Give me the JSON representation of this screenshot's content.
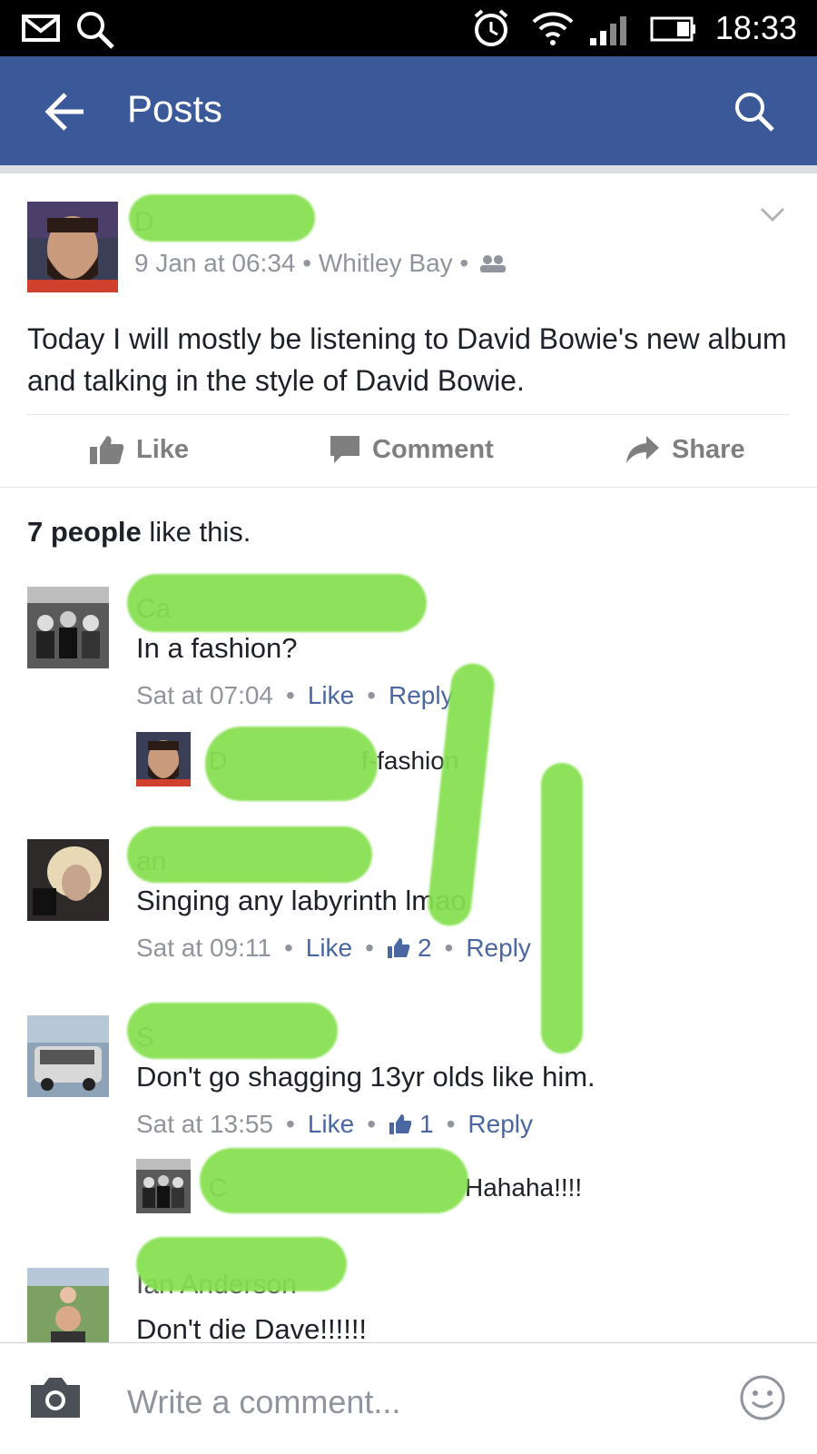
{
  "status_bar": {
    "time": "18:33"
  },
  "header": {
    "title": "Posts"
  },
  "post": {
    "author_initial": "D",
    "meta": "9 Jan at 06:34 • Whitley Bay •",
    "text": "Today I will mostly be listening to David Bowie's new album and talking in the style of David Bowie.",
    "actions": {
      "like": "Like",
      "comment": "Comment",
      "share": "Share"
    }
  },
  "likes": {
    "count": "7 people",
    "suffix": " like this."
  },
  "comments": [
    {
      "name_visible": "Ca",
      "text": "In a fashion?",
      "time": "Sat at 07:04",
      "like": "Like",
      "reply": "Reply"
    },
    {
      "name_visible": "an",
      "text": "Singing any labyrinth lmao",
      "time": "Sat at 09:11",
      "like": "Like",
      "like_count": "2",
      "reply": "Reply"
    },
    {
      "name_visible": "S",
      "text": "Don't go shagging 13yr olds like him.",
      "time": "Sat at 13:55",
      "like": "Like",
      "like_count": "1",
      "reply": "Reply"
    },
    {
      "name_visible": "Ian Anderson",
      "text": "Don't die Dave!!!!!!"
    }
  ],
  "replies": [
    {
      "name_visible": "D",
      "text": "f-fashion"
    },
    {
      "name_visible": "C",
      "text": "Hahaha!!!!"
    }
  ],
  "composer": {
    "placeholder": "Write a comment..."
  },
  "colors": {
    "header": "#3b5998",
    "link": "#4b67a1",
    "meta": "#90949c",
    "redaction": "#86e04f"
  }
}
